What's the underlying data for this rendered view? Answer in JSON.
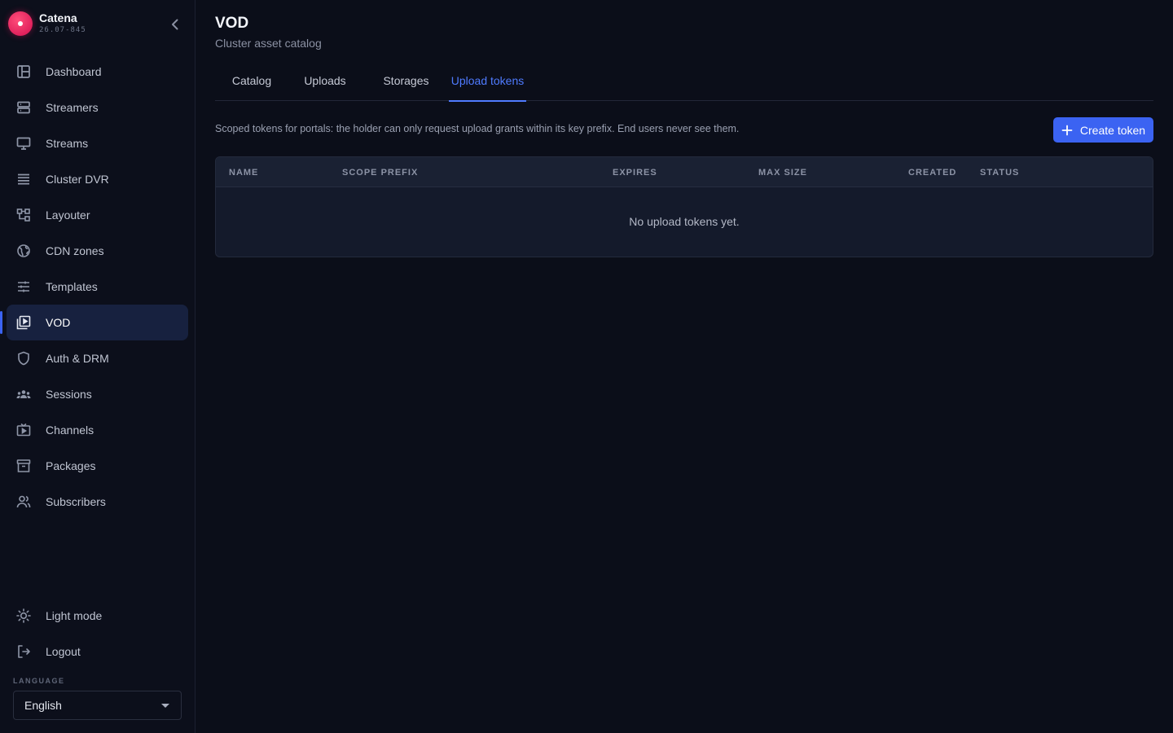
{
  "brand": {
    "name": "Catena",
    "version": "26.07-845"
  },
  "nav": {
    "items": [
      {
        "label": "Dashboard",
        "icon": "dashboard-icon"
      },
      {
        "label": "Streamers",
        "icon": "server-icon"
      },
      {
        "label": "Streams",
        "icon": "monitor-icon"
      },
      {
        "label": "Cluster DVR",
        "icon": "storage-icon"
      },
      {
        "label": "Layouter",
        "icon": "layout-icon"
      },
      {
        "label": "CDN zones",
        "icon": "globe-icon"
      },
      {
        "label": "Templates",
        "icon": "sliders-icon"
      },
      {
        "label": "VOD",
        "icon": "video-library-icon",
        "active": true
      },
      {
        "label": "Auth & DRM",
        "icon": "shield-icon"
      },
      {
        "label": "Sessions",
        "icon": "users-group-icon"
      },
      {
        "label": "Channels",
        "icon": "tv-icon"
      },
      {
        "label": "Packages",
        "icon": "archive-icon"
      },
      {
        "label": "Subscribers",
        "icon": "users-icon"
      }
    ],
    "bottom": [
      {
        "label": "Light mode",
        "icon": "sun-icon"
      },
      {
        "label": "Logout",
        "icon": "logout-icon"
      }
    ]
  },
  "language": {
    "label": "LANGUAGE",
    "selected": "English"
  },
  "page": {
    "title": "VOD",
    "subtitle": "Cluster asset catalog"
  },
  "tabs": [
    {
      "label": "Catalog"
    },
    {
      "label": "Uploads"
    },
    {
      "label": "Storages"
    },
    {
      "label": "Upload tokens",
      "active": true
    }
  ],
  "content": {
    "description": "Scoped tokens for portals: the holder can only request upload grants within its key prefix. End users never see them.",
    "create_label": "Create token",
    "columns": [
      "NAME",
      "SCOPE PREFIX",
      "EXPIRES",
      "MAX SIZE",
      "CREATED",
      "STATUS"
    ],
    "empty_text": "No upload tokens yet."
  },
  "colors": {
    "accent": "#3b63f2",
    "tab_active": "#4f7bff",
    "brand": "#e6145a",
    "background": "#0b0e19"
  }
}
